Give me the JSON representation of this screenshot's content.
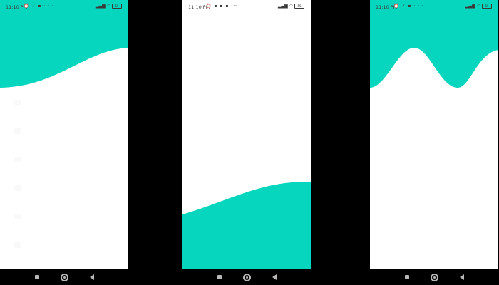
{
  "colors": {
    "accent": "#06d6be",
    "background": "#000000",
    "screen": "#ffffff"
  },
  "screens": [
    {
      "name": "wave-top-gentle",
      "status": {
        "time": "11:10 PM",
        "icons": "⏰ ✓ ▪ · · ·",
        "battery": "55"
      }
    },
    {
      "name": "wave-bottom",
      "status": {
        "time": "11:10 PM",
        "icons": "⏰ ▪ ▪ ▪ ···",
        "battery": "55"
      }
    },
    {
      "name": "wave-top-peak",
      "status": {
        "time": "11:10 PM",
        "icons": "⏰ ✓ ▪ · · ·",
        "battery": "55"
      }
    }
  ],
  "navbar": {
    "recent_icon": "square-icon",
    "home_icon": "circle-home-icon",
    "back_icon": "triangle-back-icon"
  }
}
